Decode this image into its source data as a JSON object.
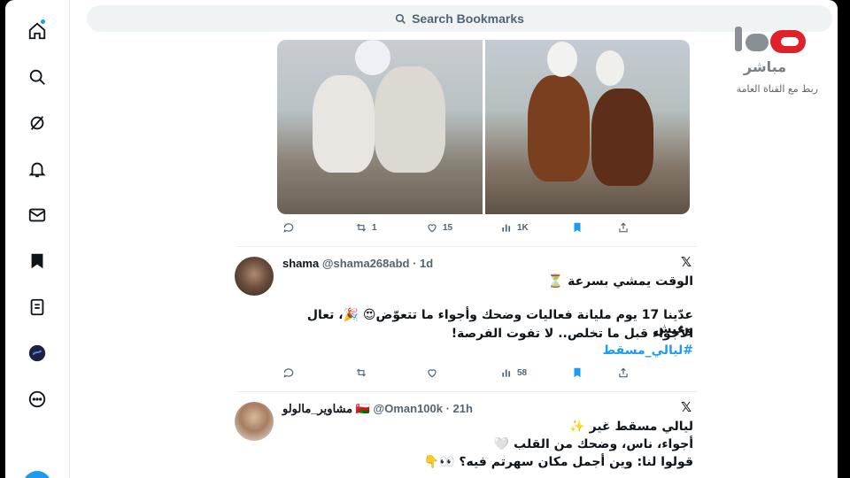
{
  "search": {
    "label": "Search Bookmarks"
  },
  "sidebar": {
    "items": [
      {
        "name": "home-icon"
      },
      {
        "name": "explore-icon"
      },
      {
        "name": "grok-icon"
      },
      {
        "name": "notifications-icon"
      },
      {
        "name": "messages-icon"
      },
      {
        "name": "bookmarks-icon"
      },
      {
        "name": "lists-icon"
      },
      {
        "name": "profile-icon"
      },
      {
        "name": "more-icon"
      }
    ]
  },
  "tweet1": {
    "reply_count": "",
    "retweet_count": "1",
    "like_count": "15",
    "view_count": "1K"
  },
  "tweet2": {
    "name": "shama",
    "handle_time": "@shama268abd · 1d",
    "line1": "الوقت يمشي بسرعة ⏳",
    "line2": "عدّينا 17 يوم مليانة فعاليات وضحك وأجواء ما تتعوّض😍 🎉، تعال وعيش",
    "line3": "الأجواء قبل ما تخلص.. لا تفوت الفرصة!",
    "hashtag": "#ليالي_مسقط",
    "view_count": "58"
  },
  "tweet3": {
    "name": "مشاوير_مالولو 🇴🇲",
    "handle_time": "@Oman100k · 21h",
    "line1": "ليالي مسقط غير ✨",
    "line2": "أجواء، ناس، وضحك من القلب 🤍",
    "line3": "قولوا لنا: وين أجمل مكان سهرتم فيه؟ 👀👇"
  },
  "broadcaster": {
    "name": "مباشر",
    "caption": "ربط مع القناة العامة"
  },
  "colors": {
    "accent": "#1d9bf0",
    "logo_red": "#e0212b",
    "logo_gray": "#8a8f94"
  }
}
